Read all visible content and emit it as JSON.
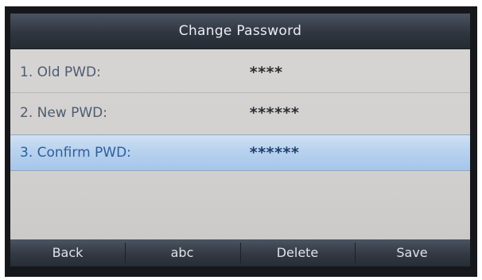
{
  "screen": {
    "title": "Change Password"
  },
  "fields": [
    {
      "label": "1. Old PWD:",
      "value": "****"
    },
    {
      "label": "2. New PWD:",
      "value": "******"
    },
    {
      "label": "3. Confirm PWD:",
      "value": "******"
    }
  ],
  "softkeys": {
    "back": "Back",
    "abc": "abc",
    "delete": "Delete",
    "save": "Save"
  },
  "colors": {
    "highlight": "#b8d2ee",
    "titlebar": "#2f3640",
    "label_text": "#4d5c70"
  }
}
